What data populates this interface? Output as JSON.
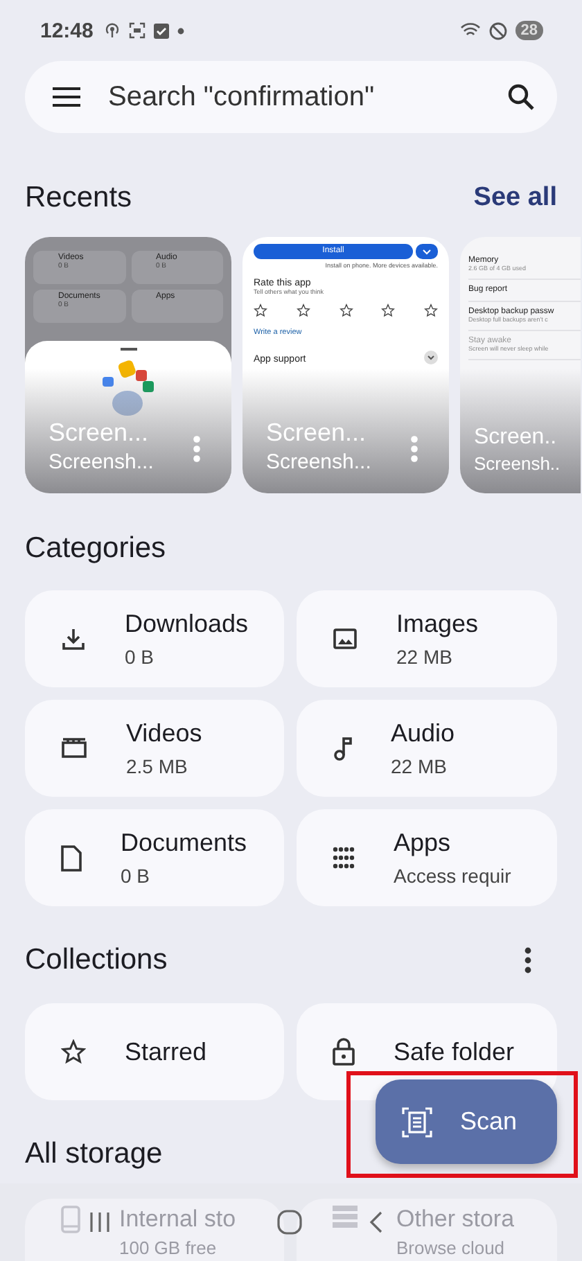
{
  "status_bar": {
    "time": "12:48",
    "battery": "28"
  },
  "search": {
    "placeholder": "Search \"confirmation\""
  },
  "recents": {
    "title": "Recents",
    "action": "See all",
    "items": [
      {
        "kind": "files",
        "caption": "Screen...",
        "subcaption": "Screensh...",
        "lines": [
          {
            "name": "Videos",
            "size": "0 B"
          },
          {
            "name": "Audio",
            "size": "0 B"
          },
          {
            "name": "Documents",
            "size": "0 B"
          },
          {
            "name": "Apps"
          }
        ]
      },
      {
        "kind": "store",
        "caption": "Screen...",
        "subcaption": "Screensh...",
        "button": "Install",
        "note": "Install on phone. More devices available.",
        "heading": "Rate this app",
        "hint": "Tell others what you think",
        "link": "Write a review",
        "section": "App support"
      },
      {
        "kind": "settings",
        "caption": "Screen..",
        "subcaption": "Screensh..",
        "lines": [
          {
            "name": "Memory",
            "size": "2.6 GB of 4 GB used"
          },
          {
            "name": "Bug report"
          },
          {
            "name": "Desktop backup passw",
            "size": "Desktop full backups aren't c"
          },
          {
            "name": "Stay awake",
            "size": "Screen will never sleep while"
          }
        ]
      }
    ]
  },
  "categories": {
    "title": "Categories",
    "items": [
      {
        "name": "Downloads",
        "detail": "0 B"
      },
      {
        "name": "Images",
        "detail": "22 MB"
      },
      {
        "name": "Videos",
        "detail": "2.5 MB"
      },
      {
        "name": "Audio",
        "detail": "22 MB"
      },
      {
        "name": "Documents",
        "detail": "0 B"
      },
      {
        "name": "Apps",
        "detail": "Access requir"
      }
    ]
  },
  "collections": {
    "title": "Collections",
    "items": [
      {
        "name": "Starred"
      },
      {
        "name": "Safe folder"
      }
    ]
  },
  "storage": {
    "title": "All storage",
    "items": [
      {
        "name": "Internal sto",
        "detail": "100 GB free"
      },
      {
        "name": "Other stora",
        "detail": "Browse cloud"
      }
    ]
  },
  "fab": {
    "label": "Scan",
    "highlighted": true
  }
}
